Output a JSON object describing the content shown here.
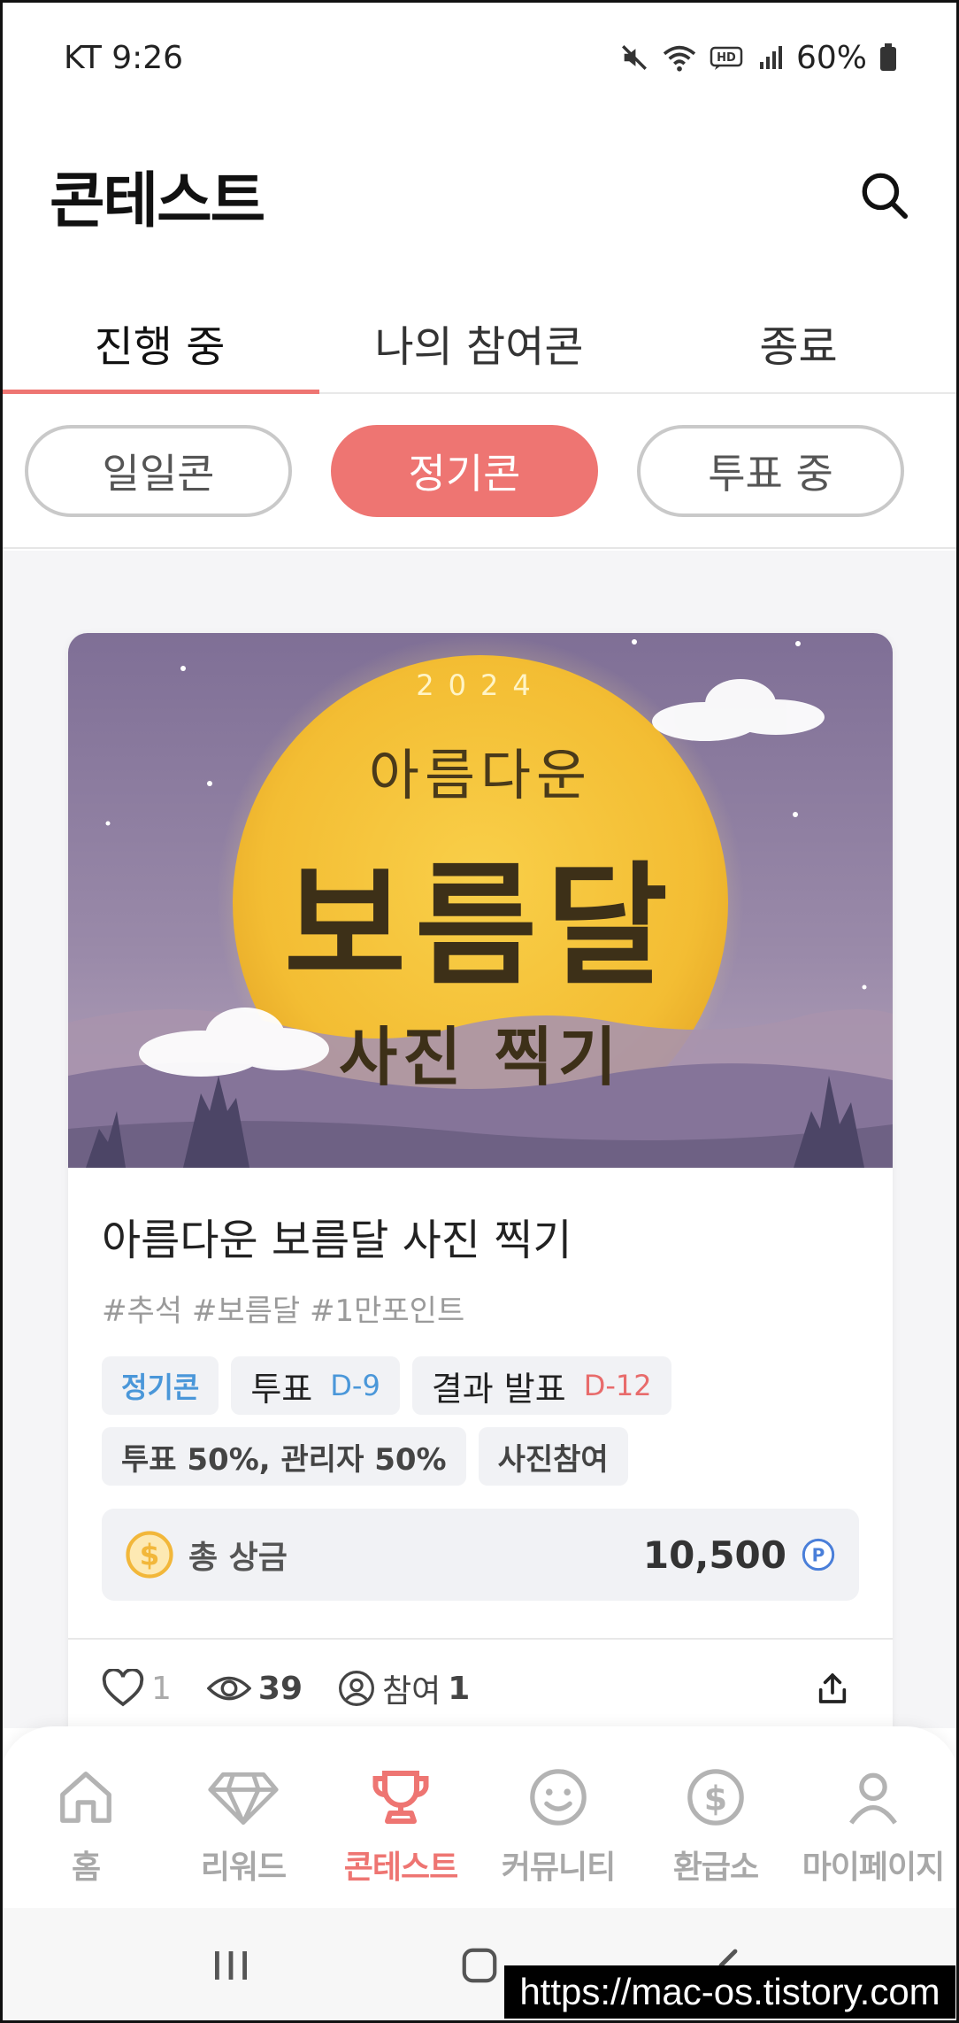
{
  "status_bar": {
    "carrier_time": "KT 9:26",
    "battery": "60%"
  },
  "header": {
    "title": "콘테스트"
  },
  "tabs": [
    {
      "label": "진행 중",
      "active": true
    },
    {
      "label": "나의 참여콘",
      "active": false
    },
    {
      "label": "종료",
      "active": false
    }
  ],
  "chips": [
    {
      "label": "일일콘",
      "active": false
    },
    {
      "label": "정기콘",
      "active": true
    },
    {
      "label": "투표 중",
      "active": false
    }
  ],
  "card": {
    "banner": {
      "year": "2024",
      "line1": "아름다운",
      "line2": "보름달",
      "line3": "사진 찍기"
    },
    "title": "아름다운 보름달 사진 찍기",
    "tags": "#추석 #보름달 #1만포인트",
    "badge_type": "정기콘",
    "vote_label": "투표",
    "vote_dday": "D-9",
    "result_label": "결과 발표",
    "result_dday": "D-12",
    "ratio": "투표 50%, 관리자 50%",
    "method": "사진참여",
    "prize_label": "총 상금",
    "prize_value": "10,500",
    "likes": "1",
    "views": "39",
    "participate_label": "참여",
    "participants": "1"
  },
  "bottom_nav": [
    {
      "label": "홈",
      "icon": "home-icon"
    },
    {
      "label": "리워드",
      "icon": "diamond-icon"
    },
    {
      "label": "콘테스트",
      "icon": "trophy-icon",
      "active": true
    },
    {
      "label": "커뮤니티",
      "icon": "smile-icon"
    },
    {
      "label": "환급소",
      "icon": "dollar-icon"
    },
    {
      "label": "마이페이지",
      "icon": "person-icon"
    }
  ],
  "watermark": "https://mac-os.tistory.com",
  "colors": {
    "accent": "#ee7572",
    "blue": "#4a97d9",
    "coin": "#f2b73a"
  }
}
